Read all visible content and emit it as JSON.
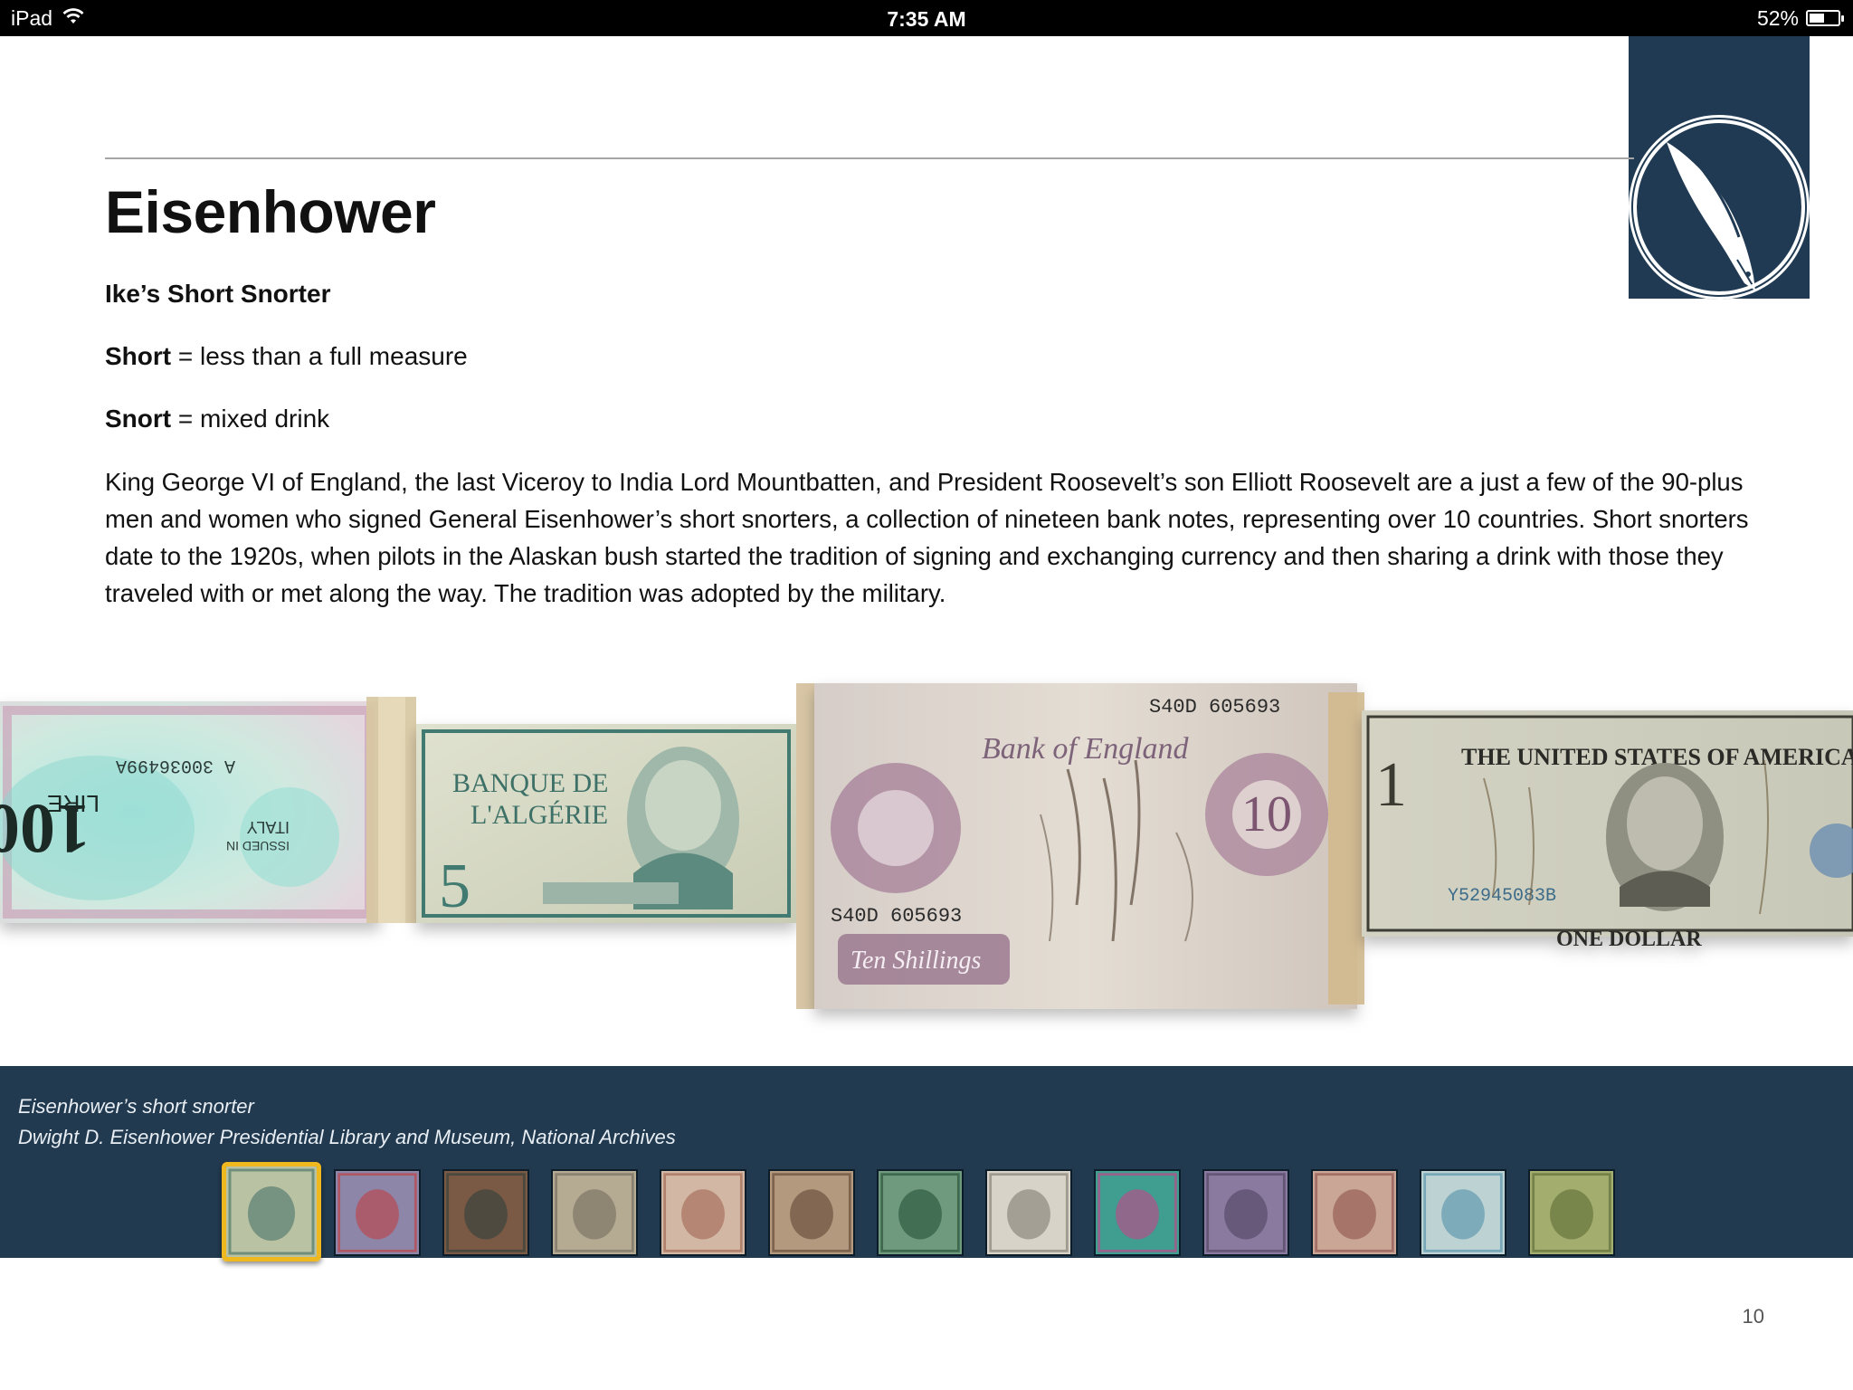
{
  "status_bar": {
    "device": "iPad",
    "time": "7:35 AM",
    "battery": "52%",
    "battery_level": 0.52
  },
  "page": {
    "title": "Eisenhower",
    "subtitle": "Ike’s Short Snorter",
    "definitions": [
      {
        "term": "Short",
        "meaning": " = less than a full measure"
      },
      {
        "term": "Snort",
        "meaning": " = mixed drink"
      }
    ],
    "body": "King George VI of England, the last Viceroy to India Lord Mountbatten, and President Roosevelt’s son Elliott Roosevelt are a just a few of the 90-plus men and women who signed General Eisenhower’s short snorters, a collection of nineteen bank notes, representing over 10 countries. Short snorters date to the 1920s, when pilots in the Alaskan bush started the tradition of signing and exchanging currency and then sharing a drink with those they traveled with or met along the way. The tradition was adopted by the military.",
    "page_number": "10"
  },
  "banknotes": {
    "italy_value": "100",
    "italy_word": "LIRE",
    "italy_serial": "A 30036499A",
    "italy_issued": "ISSUED IN",
    "italy_country": "ITALY",
    "algeria_bank": "BANQUE DE",
    "algeria_country": "L'ALGÉRIE",
    "algeria_value": "5",
    "england_serial": "S40D 605693",
    "england_bank": "Bank of England",
    "england_value": "10",
    "england_label": "Ten Shillings",
    "us_header": "THE UNITED STATES OF AMERICA",
    "us_serial": "Y52945083B",
    "us_value": "1",
    "us_label": "ONE DOLLAR"
  },
  "caption": {
    "line1": "Eisenhower’s short snorter",
    "line2": "Dwight D. Eisenhower Presidential Library and Museum, National Archives"
  },
  "thumbnails": [
    {
      "color": "#b9c3a4",
      "accent": "#3f6a63"
    },
    {
      "color": "#8d86a8",
      "accent": "#c43a3a"
    },
    {
      "color": "#7a5a45",
      "accent": "#2c3e3a"
    },
    {
      "color": "#b5aa92",
      "accent": "#6e665a"
    },
    {
      "color": "#d2b8a4",
      "accent": "#9a5d4a"
    },
    {
      "color": "#b39a7e",
      "accent": "#5a4030"
    },
    {
      "color": "#6f9a7e",
      "accent": "#1e4a30"
    },
    {
      "color": "#d8d3c8",
      "accent": "#7a746a"
    },
    {
      "color": "#3f9e8f",
      "accent": "#d23c8a"
    },
    {
      "color": "#8a7aa0",
      "accent": "#4b3e5a"
    },
    {
      "color": "#c9a696",
      "accent": "#8b4a45"
    },
    {
      "color": "#bdd3d3",
      "accent": "#4a8aa6"
    },
    {
      "color": "#a3ad6e",
      "accent": "#55642f"
    }
  ]
}
